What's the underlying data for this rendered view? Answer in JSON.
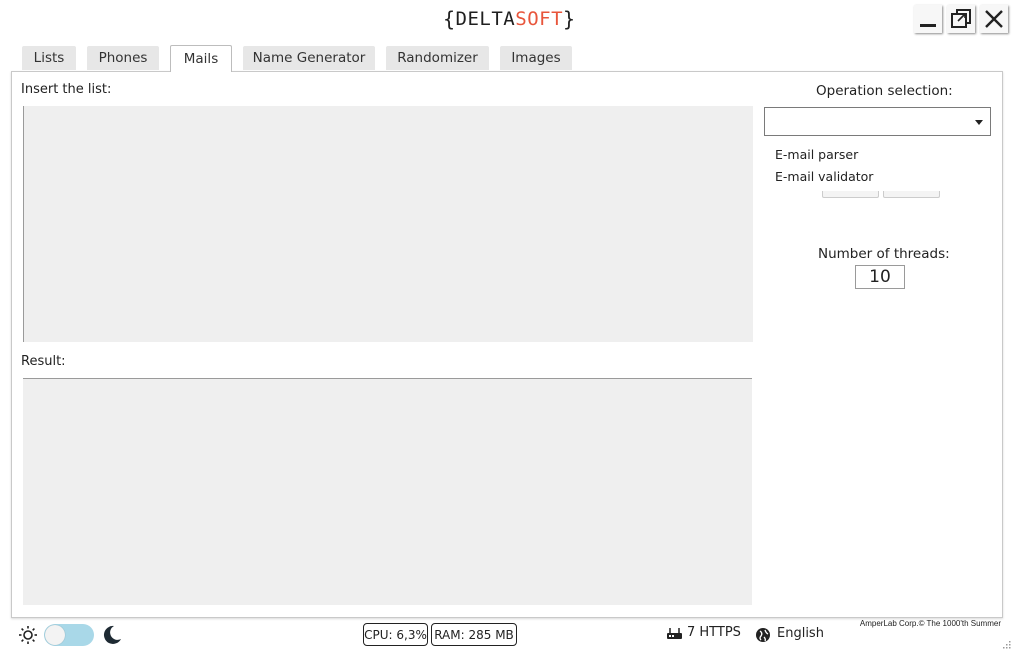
{
  "app": {
    "logo_part1": "DELTA",
    "logo_part2": "SOFT",
    "logo_brace_open": "{",
    "logo_brace_close": "}"
  },
  "window_controls": [
    {
      "name": "minimize-button",
      "icon": "minimize-icon"
    },
    {
      "name": "restore-button",
      "icon": "restore-icon"
    },
    {
      "name": "close-button",
      "icon": "close-icon"
    }
  ],
  "tabs": [
    {
      "label": "Lists",
      "active": false
    },
    {
      "label": "Phones",
      "active": false
    },
    {
      "label": "Mails",
      "active": true
    },
    {
      "label": "Name Generator",
      "active": false
    },
    {
      "label": "Randomizer",
      "active": false
    },
    {
      "label": "Images",
      "active": false
    }
  ],
  "mails": {
    "insert_label": "Insert the list:",
    "result_label": "Result:",
    "insert_value": "",
    "result_value": "",
    "operation_label": "Operation selection:",
    "operation_selected": "",
    "operation_options": [
      "E-mail parser",
      "E-mail validator"
    ],
    "threads_label": "Number of threads:",
    "threads_value": "10"
  },
  "status": {
    "theme_light_icon": "sun-icon",
    "theme_dark_icon": "moon-icon",
    "cpu": "CPU: 6,3%",
    "ram": "RAM: 285 MB",
    "proxy": "7 HTTPS",
    "language": "English",
    "copyright": "AmperLab Corp.© The 1000'th Summer"
  },
  "colors": {
    "accent": "#e8553b",
    "toggle": "#a9d8e8",
    "textarea_bg": "#efefef"
  }
}
